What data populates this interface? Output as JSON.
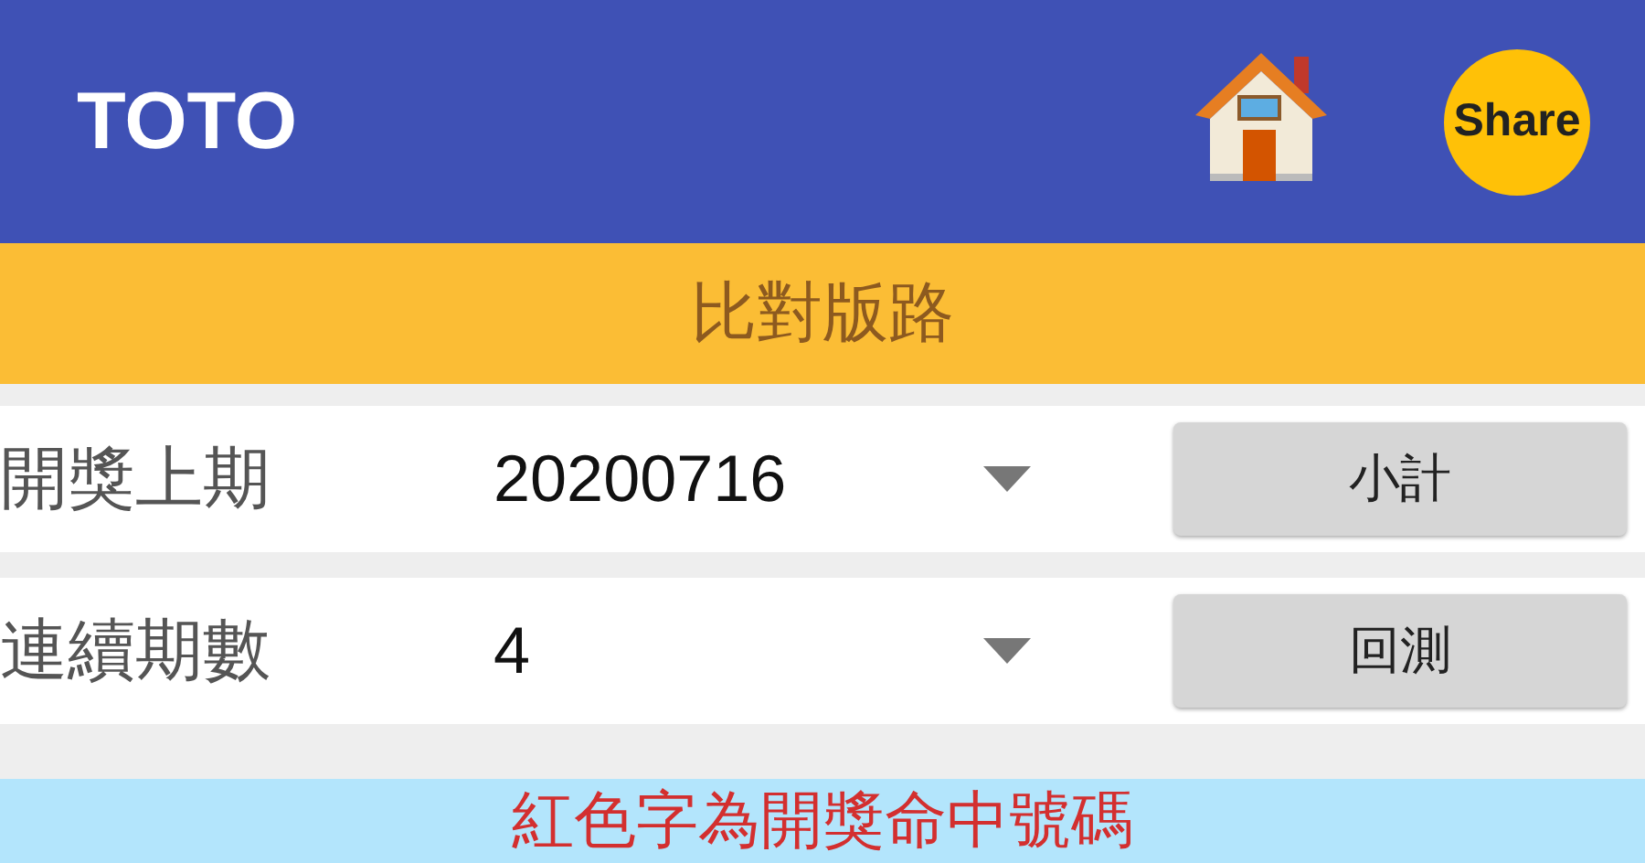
{
  "app_bar": {
    "title": "TOTO",
    "share_label": "Share"
  },
  "section_header": "比對版路",
  "rows": [
    {
      "label": "開獎上期",
      "value": "20200716",
      "button": "小計"
    },
    {
      "label": "連續期數",
      "value": "4",
      "button": "回測"
    }
  ],
  "notice": "紅色字為開獎命中號碼"
}
